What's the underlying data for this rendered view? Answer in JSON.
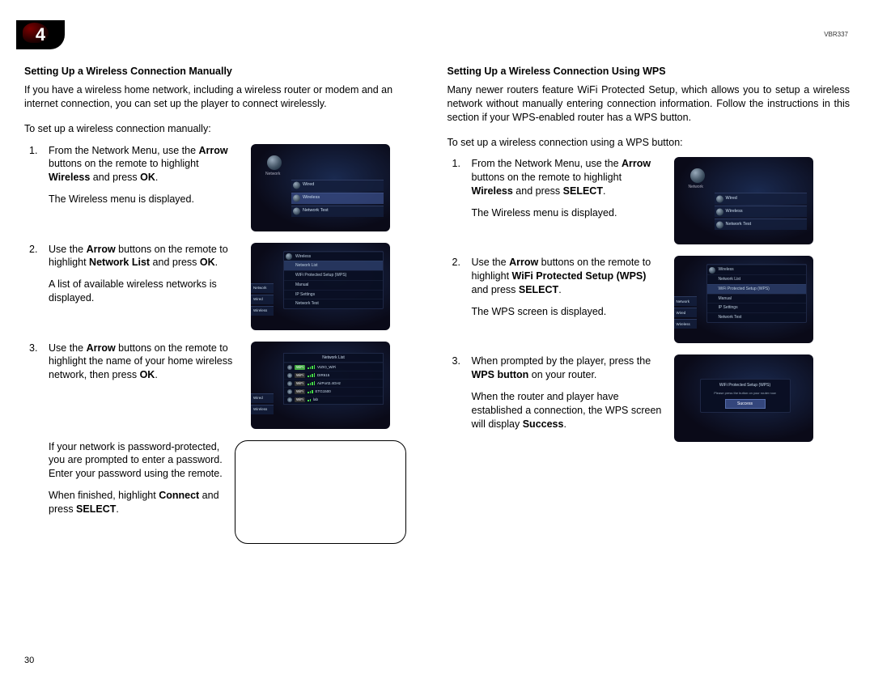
{
  "chapter_number": "4",
  "model_code": "VBR337",
  "page_number": "30",
  "left": {
    "title": "Setting Up a Wireless Connection Manually",
    "intro": "If you have a wireless home network, including a wireless router or modem and an internet connection, you can set up the player to connect wirelessly.",
    "lead": "To set up a wireless connection manually:",
    "steps": {
      "s1a": "From the Network Menu, use the ",
      "s1b": "Arrow",
      "s1c": " buttons on the remote to highlight ",
      "s1d": "Wireless",
      "s1e": " and press ",
      "s1f": "OK",
      "s1g": ".",
      "s1_sub": "The Wireless menu is displayed.",
      "s2a": "Use the ",
      "s2b": "Arrow",
      "s2c": " buttons on the remote to highlight ",
      "s2d": "Network List",
      "s2e": " and press ",
      "s2f": "OK",
      "s2g": ".",
      "s2_sub": "A list of available wireless networks is displayed.",
      "s3a": "Use the ",
      "s3b": "Arrow",
      "s3c": " buttons on the remote to highlight the name of your home wireless network, then press ",
      "s3d": "OK",
      "s3e": ".",
      "s4a": "If your network is password-protected, you are prompted to enter a password. Enter your password using the remote.",
      "s4b_a": "When finished, highlight ",
      "s4b_b": "Connect",
      "s4b_c": " and press ",
      "s4b_d": "SELECT",
      "s4b_e": "."
    },
    "screens": {
      "network_menu": {
        "label_network": "Network",
        "row1": "Wired",
        "row2": "Wireless",
        "row3": "Network Test"
      },
      "wireless_submenu": {
        "hdr": "Wireless",
        "r1": "Network List",
        "r2": "WiFi Protected Setup (WPS)",
        "r3": "Manual",
        "r4": "IP Settings",
        "r5": "Network Test"
      },
      "side_rows": {
        "r0": "Network",
        "r1": "Wired",
        "r2": "Wireless"
      },
      "netlist": {
        "hdr": "Network List",
        "n1": "VIZIO_WiFi",
        "n2": "DIR615",
        "n3": "AirPort2.4GHz",
        "n4": "ETG1500",
        "n5": "lab"
      }
    }
  },
  "right": {
    "title": "Setting Up a Wireless Connection Using WPS",
    "intro": "Many newer routers feature WiFi Protected Setup, which allows you to setup a wireless network without manually entering connection information. Follow the instructions in this section if your WPS-enabled router has a WPS button.",
    "lead": "To set up a wireless connection using a WPS button:",
    "steps": {
      "s1a": "From the Network Menu, use the ",
      "s1b": "Arrow",
      "s1c": " buttons on the remote to highlight ",
      "s1d": "Wireless",
      "s1e": " and press ",
      "s1f": "SELECT",
      "s1g": ".",
      "s1_sub": "The Wireless menu is displayed.",
      "s2a": "Use the ",
      "s2b": "Arrow",
      "s2c": " buttons on the remote to highlight ",
      "s2d": "WiFi Protected Setup (WPS)",
      "s2e": " and press ",
      "s2f": "SELECT",
      "s2g": ".",
      "s2_sub": "The WPS screen is displayed.",
      "s3a": "When prompted by the player, press the ",
      "s3b": "WPS button",
      "s3c": " on your router.",
      "s3_sub_a": "When the router and player have established a connection, the WPS screen will display ",
      "s3_sub_b": "Success",
      "s3_sub_c": "."
    },
    "screens": {
      "wps_dialog": {
        "title": "WiFi Protected Setup (WPS)",
        "line": "Please press the button on your router now",
        "btn": "Success"
      }
    }
  }
}
